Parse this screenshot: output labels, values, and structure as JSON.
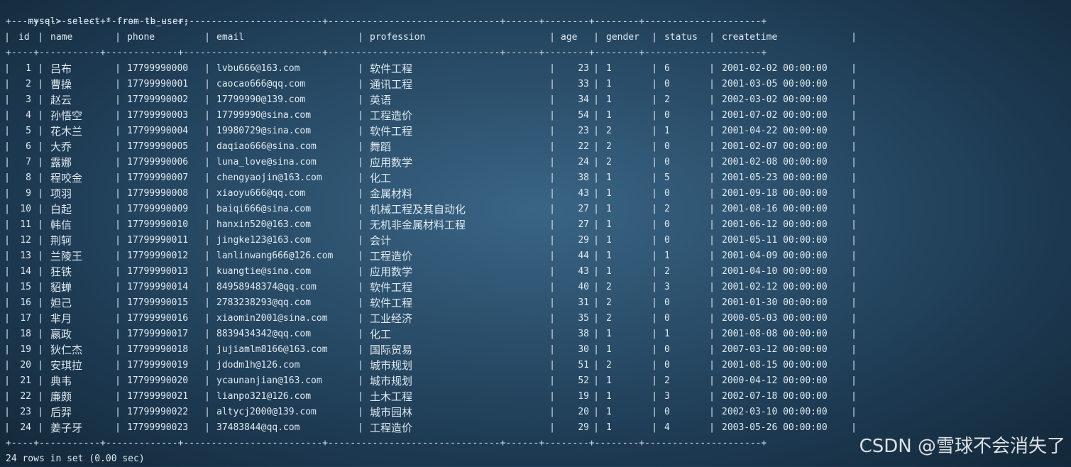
{
  "terminal": {
    "prompt": "mysql>",
    "command": "select * from tb_user;",
    "border_line": "+----+-----------+-------------+-------------------------+-------------------------------+------+--------+--------+---------------------+",
    "footer": "24 rows in set (0.00 sec)"
  },
  "table": {
    "columns": [
      "id",
      "name",
      "phone",
      "email",
      "profession",
      "age",
      "gender",
      "status",
      "createtime"
    ],
    "rows": [
      [
        "1",
        "吕布",
        "17799990000",
        "lvbu666@163.com",
        "软件工程",
        "23",
        "1",
        "6",
        "2001-02-02 00:00:00"
      ],
      [
        "2",
        "曹操",
        "17799990001",
        "caocao666@qq.com",
        "通讯工程",
        "33",
        "1",
        "0",
        "2001-03-05 00:00:00"
      ],
      [
        "3",
        "赵云",
        "17799990002",
        "17799990@139.com",
        "英语",
        "34",
        "1",
        "2",
        "2002-03-02 00:00:00"
      ],
      [
        "4",
        "孙悟空",
        "17799990003",
        "17799990@sina.com",
        "工程造价",
        "54",
        "1",
        "0",
        "2001-07-02 00:00:00"
      ],
      [
        "5",
        "花木兰",
        "17799990004",
        "19980729@sina.com",
        "软件工程",
        "23",
        "2",
        "1",
        "2001-04-22 00:00:00"
      ],
      [
        "6",
        "大乔",
        "17799990005",
        "daqiao666@sina.com",
        "舞蹈",
        "22",
        "2",
        "0",
        "2001-02-07 00:00:00"
      ],
      [
        "7",
        "露娜",
        "17799990006",
        "luna_love@sina.com",
        "应用数学",
        "24",
        "2",
        "0",
        "2001-02-08 00:00:00"
      ],
      [
        "8",
        "程咬金",
        "17799990007",
        "chengyaojin@163.com",
        "化工",
        "38",
        "1",
        "5",
        "2001-05-23 00:00:00"
      ],
      [
        "9",
        "项羽",
        "17799990008",
        "xiaoyu666@qq.com",
        "金属材料",
        "43",
        "1",
        "0",
        "2001-09-18 00:00:00"
      ],
      [
        "10",
        "白起",
        "17799990009",
        "baiqi666@sina.com",
        "机械工程及其自动化",
        "27",
        "1",
        "2",
        "2001-08-16 00:00:00"
      ],
      [
        "11",
        "韩信",
        "17799990010",
        "hanxin520@163.com",
        "无机非金属材料工程",
        "27",
        "1",
        "0",
        "2001-06-12 00:00:00"
      ],
      [
        "12",
        "荆轲",
        "17799990011",
        "jingke123@163.com",
        "会计",
        "29",
        "1",
        "0",
        "2001-05-11 00:00:00"
      ],
      [
        "13",
        "兰陵王",
        "17799990012",
        "lanlinwang666@126.com",
        "工程造价",
        "44",
        "1",
        "1",
        "2001-04-09 00:00:00"
      ],
      [
        "14",
        "狂铁",
        "17799990013",
        "kuangtie@sina.com",
        "应用数学",
        "43",
        "1",
        "2",
        "2001-04-10 00:00:00"
      ],
      [
        "15",
        "貂蝉",
        "17799990014",
        "84958948374@qq.com",
        "软件工程",
        "40",
        "2",
        "3",
        "2001-02-12 00:00:00"
      ],
      [
        "16",
        "妲己",
        "17799990015",
        "2783238293@qq.com",
        "软件工程",
        "31",
        "2",
        "0",
        "2001-01-30 00:00:00"
      ],
      [
        "17",
        "芈月",
        "17799990016",
        "xiaomin2001@sina.com",
        "工业经济",
        "35",
        "2",
        "0",
        "2000-05-03 00:00:00"
      ],
      [
        "18",
        "嬴政",
        "17799990017",
        "8839434342@qq.com",
        "化工",
        "38",
        "1",
        "1",
        "2001-08-08 00:00:00"
      ],
      [
        "19",
        "狄仁杰",
        "17799990018",
        "jujiamlm8166@163.com",
        "国际贸易",
        "30",
        "1",
        "0",
        "2007-03-12 00:00:00"
      ],
      [
        "20",
        "安琪拉",
        "17799990019",
        "jdodm1h@126.com",
        "城市规划",
        "51",
        "2",
        "0",
        "2001-08-15 00:00:00"
      ],
      [
        "21",
        "典韦",
        "17799990020",
        "ycaunanjian@163.com",
        "城市规划",
        "52",
        "1",
        "2",
        "2000-04-12 00:00:00"
      ],
      [
        "22",
        "廉颇",
        "17799990021",
        "lianpo321@126.com",
        "土木工程",
        "19",
        "1",
        "3",
        "2002-07-18 00:00:00"
      ],
      [
        "23",
        "后羿",
        "17799990022",
        "altycj2000@139.com",
        "城市园林",
        "20",
        "1",
        "0",
        "2002-03-10 00:00:00"
      ],
      [
        "24",
        "姜子牙",
        "17799990023",
        "37483844@qq.com",
        "工程造价",
        "29",
        "1",
        "4",
        "2003-05-26 00:00:00"
      ]
    ]
  },
  "watermark": "CSDN @雪球不会消失了",
  "colors": {
    "text": "#dfe9f0",
    "background": "#2b4f6b"
  }
}
